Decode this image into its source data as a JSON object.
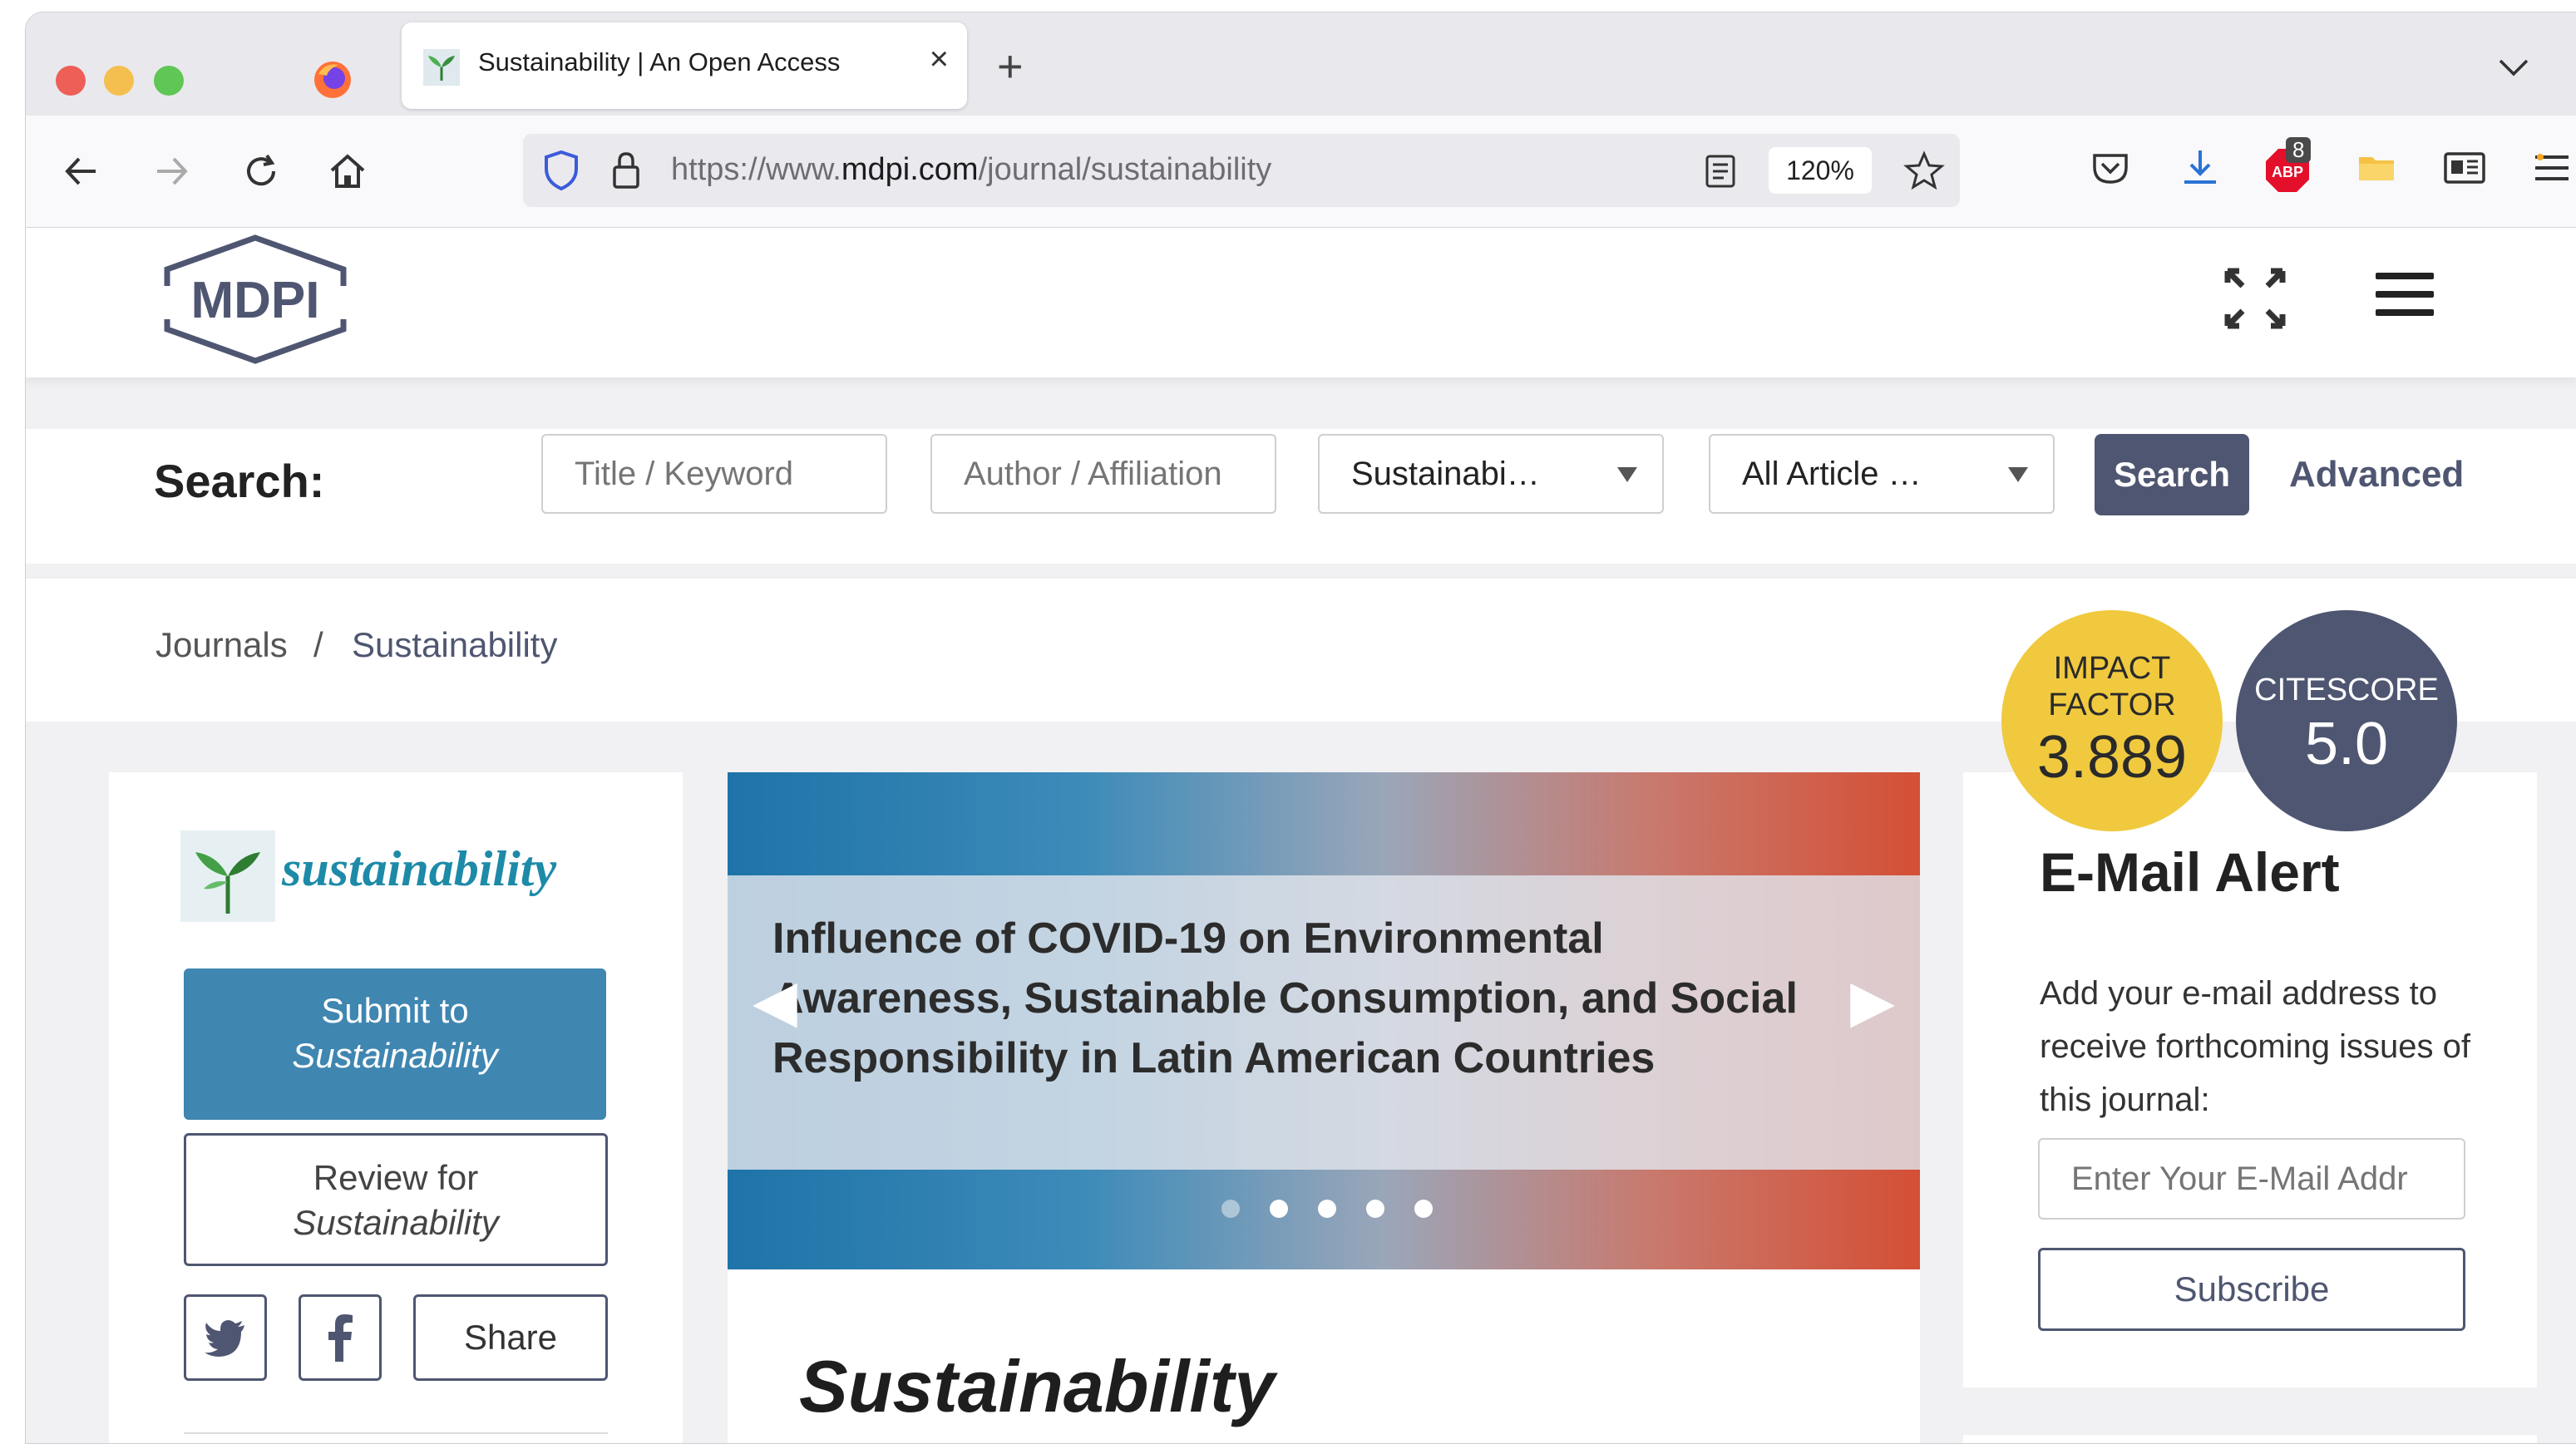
{
  "browser": {
    "tab_title": "Sustainability | An Open Access",
    "url_prefix": "https://www.",
    "url_domain": "mdpi.com",
    "url_path": "/journal/sustainability",
    "zoom": "120%",
    "notification_count": "8"
  },
  "site": {
    "logo_text": "MDPI"
  },
  "search": {
    "label": "Search:",
    "keyword_placeholder": "Title / Keyword",
    "author_placeholder": "Author / Affiliation",
    "journal_select": "Sustainabi…",
    "article_select": "All Article …",
    "button": "Search",
    "advanced": "Advanced"
  },
  "breadcrumb": {
    "root": "Journals",
    "separator": "/",
    "current": "Sustainability"
  },
  "badges": {
    "impact_label_1": "IMPACT",
    "impact_label_2": "FACTOR",
    "impact_value": "3.889",
    "cite_label": "CITESCORE",
    "cite_value": "5.0"
  },
  "left": {
    "journal_logo_text": "sustainability",
    "submit_line1": "Submit to",
    "submit_line2": "Sustainability",
    "review_line1": "Review for",
    "review_line2": "Sustainability",
    "share": "Share"
  },
  "slider": {
    "title": "Influence of COVID-19 on Environmental Awareness, Sustainable Consumption, and Social Responsibility in Latin American Countries",
    "slide_count": 5,
    "active_slide": 2
  },
  "main": {
    "journal_title": "Sustainability"
  },
  "email_alert": {
    "title": "E-Mail Alert",
    "description": "Add your e-mail address to receive forthcoming issues of this journal:",
    "placeholder": "Enter Your E-Mail Addr",
    "subscribe": "Subscribe"
  },
  "colors": {
    "brand_navy": "#4f5671",
    "submit_blue": "#3f86b1",
    "impact_yellow": "#f0c93f"
  }
}
